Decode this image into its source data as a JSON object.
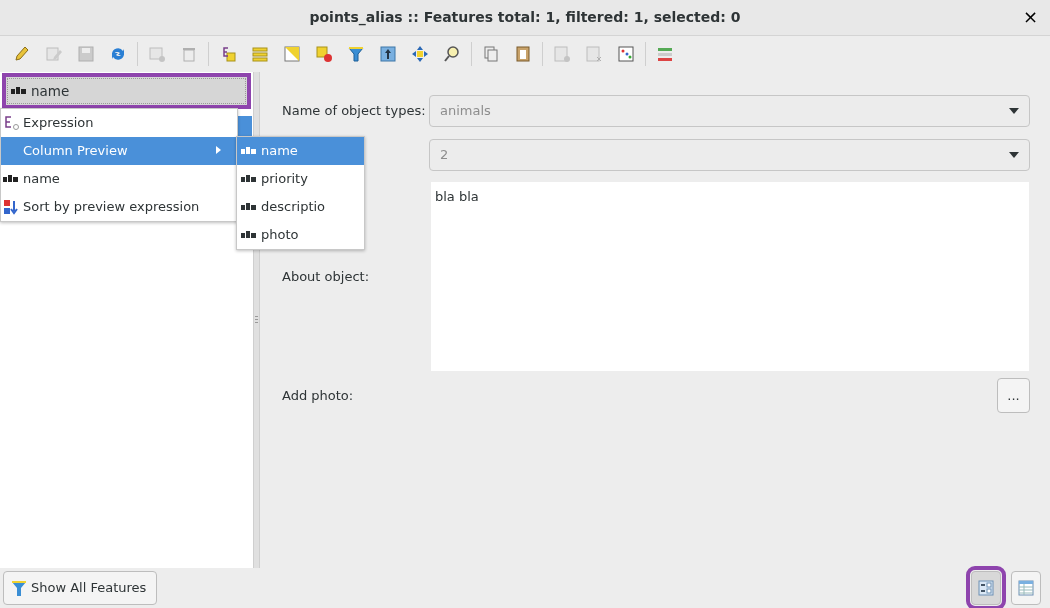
{
  "window": {
    "title": "points_alias :: Features total: 1, filtered: 1, selected: 0",
    "close": "×"
  },
  "toolbar": [
    {
      "kind": "pencil",
      "disabled": false
    },
    {
      "kind": "edit",
      "disabled": true
    },
    {
      "kind": "save",
      "disabled": true
    },
    {
      "kind": "reload",
      "disabled": false
    },
    {
      "kind": "separator"
    },
    {
      "kind": "add-row",
      "disabled": true
    },
    {
      "kind": "trash",
      "disabled": true
    },
    {
      "kind": "separator"
    },
    {
      "kind": "expression",
      "disabled": false
    },
    {
      "kind": "stack",
      "disabled": false
    },
    {
      "kind": "triangle",
      "disabled": false
    },
    {
      "kind": "deselect",
      "disabled": false
    },
    {
      "kind": "filter",
      "disabled": false
    },
    {
      "kind": "move-top",
      "disabled": false
    },
    {
      "kind": "pan",
      "disabled": false
    },
    {
      "kind": "zoom",
      "disabled": false
    },
    {
      "kind": "separator"
    },
    {
      "kind": "copy",
      "disabled": false
    },
    {
      "kind": "paste",
      "disabled": false
    },
    {
      "kind": "separator"
    },
    {
      "kind": "add-column",
      "disabled": true
    },
    {
      "kind": "delete-column",
      "disabled": true
    },
    {
      "kind": "calculator",
      "disabled": false
    },
    {
      "kind": "separator"
    },
    {
      "kind": "format",
      "disabled": false
    }
  ],
  "preview_field": {
    "value": "name",
    "highlighted": true
  },
  "feature_list": {
    "rows": [
      {
        "selected": true
      }
    ]
  },
  "menu": {
    "items": [
      {
        "kind": "expression",
        "label": "Expression",
        "selected": false
      },
      {
        "kind": "submenu",
        "label": "Column Preview",
        "selected": true
      },
      {
        "kind": "field",
        "label": "name",
        "selected": false
      },
      {
        "kind": "sort",
        "label": "Sort by preview expression",
        "selected": false
      }
    ]
  },
  "submenu": {
    "items": [
      {
        "label": "name",
        "selected": true
      },
      {
        "label": "priority",
        "selected": false
      },
      {
        "label": "descriptio",
        "selected": false
      },
      {
        "label": "photo",
        "selected": false
      }
    ]
  },
  "form": {
    "fields": [
      {
        "kind": "combo",
        "label": "Name of object types:",
        "value": "animals"
      },
      {
        "kind": "combo",
        "value": "2"
      },
      {
        "kind": "textarea",
        "label": "About object:",
        "value": "bla bla"
      },
      {
        "kind": "file",
        "label": "Add photo:",
        "button": "..."
      }
    ]
  },
  "bottom": {
    "show_all_button": "Show All Features",
    "views": [
      {
        "kind": "form",
        "selected": true,
        "highlighted": true
      },
      {
        "kind": "table",
        "selected": false,
        "highlighted": false
      }
    ]
  }
}
